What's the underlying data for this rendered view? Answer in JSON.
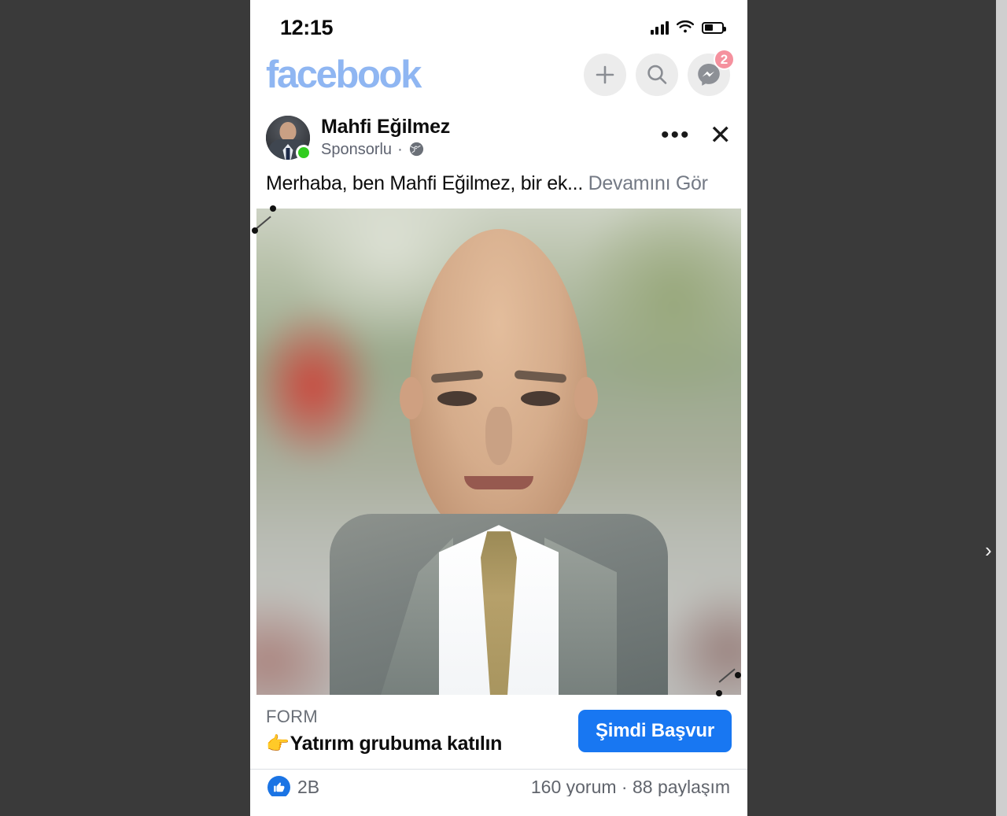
{
  "status_bar": {
    "time": "12:15",
    "signal_icon": "cellular-signal-icon",
    "wifi_icon": "wifi-icon",
    "battery_icon": "battery-icon"
  },
  "app_header": {
    "logo_text": "facebook",
    "logo_color": "#8fb6f2",
    "actions": [
      {
        "name": "create-button",
        "icon": "plus-icon"
      },
      {
        "name": "search-button",
        "icon": "search-icon"
      },
      {
        "name": "messenger-button",
        "icon": "messenger-icon",
        "badge": "2"
      }
    ]
  },
  "post": {
    "author": "Mahfi Eğilmez",
    "sponsored_label": "Sponsorlu",
    "separator": "·",
    "audience_icon": "globe-icon",
    "avatar_icon": "avatar",
    "online_status": "online",
    "menu_icon": "more-options-icon",
    "close_icon": "close-icon",
    "body_text": "Merhaba, ben Mahfi Eğilmez, bir ek...",
    "see_more_label": "Devamını Gör",
    "image_alt": "bald man in grey tweed blazer, white shirt and khaki tie outdoors"
  },
  "cta": {
    "kicker": "FORM",
    "emoji": "👉",
    "title": "Yatırım grubuma katılın",
    "button_label": "Şimdi Başvur",
    "button_color": "#1877f2"
  },
  "engagement": {
    "reaction_icon": "like-icon",
    "reaction_count": "2B",
    "comments_shares": "160 yorum · 88 paylaşım"
  },
  "overlay": {
    "edge_marker": "›",
    "selection_handles": 4
  },
  "colors": {
    "backdrop": "#3a3a3a",
    "panel": "#ffffff",
    "accent_blue": "#1877f2",
    "logo_blue": "#8fb6f2",
    "badge_pink": "#f5919e",
    "online_green": "#31cc1f",
    "muted_text": "#5e6370"
  }
}
